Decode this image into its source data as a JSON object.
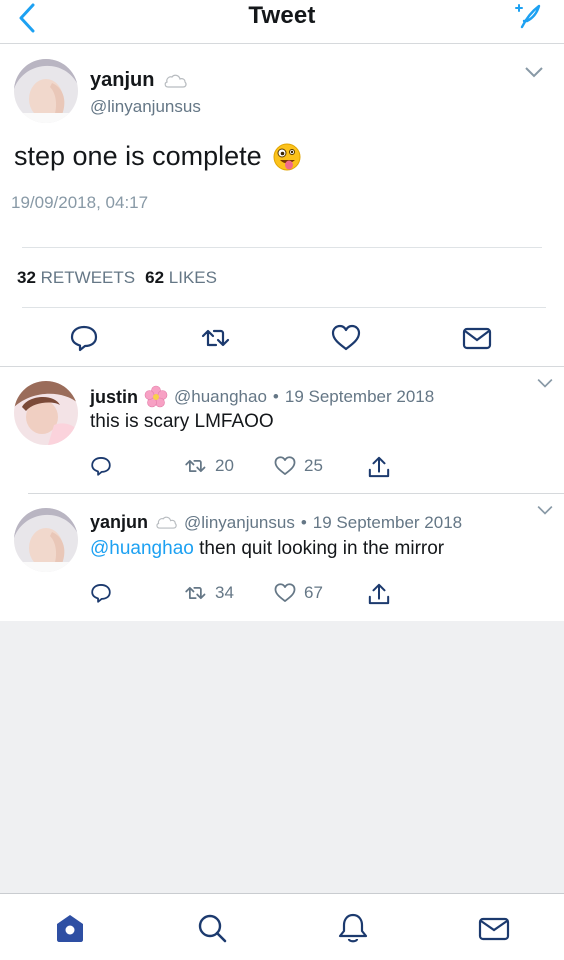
{
  "header": {
    "title": "Tweet"
  },
  "main_tweet": {
    "name": "yanjun",
    "handle": "@linyanjunsus",
    "text": "step one is complete",
    "timestamp": "19/09/2018, 04:17",
    "retweets_count": "32",
    "retweets_label": "RETWEETS",
    "likes_count": "62",
    "likes_label": "LIKES"
  },
  "replies": [
    {
      "name": "justin",
      "handle": "@huanghao",
      "date": "19 September 2018",
      "separator": "•",
      "text": "this is scary LMFAOO",
      "mention": "",
      "retweets": "20",
      "likes": "25"
    },
    {
      "name": "yanjun",
      "handle": "@linyanjunsus",
      "date": "19 September 2018",
      "separator": "•",
      "mention": "@huanghao",
      "text": " then quit looking in the mirror",
      "retweets": "34",
      "likes": "67"
    }
  ],
  "colors": {
    "accent": "#1da1f2",
    "tab_active": "#2e4fa3",
    "muted": "#657786"
  },
  "icons": [
    "back-arrow-icon",
    "compose-icon",
    "chevron-down-icon",
    "cloud-icon",
    "flower-icon",
    "zany-face-icon",
    "reply-icon",
    "retweet-icon",
    "heart-icon",
    "mail-icon",
    "share-icon",
    "home-icon",
    "search-icon",
    "bell-icon"
  ]
}
